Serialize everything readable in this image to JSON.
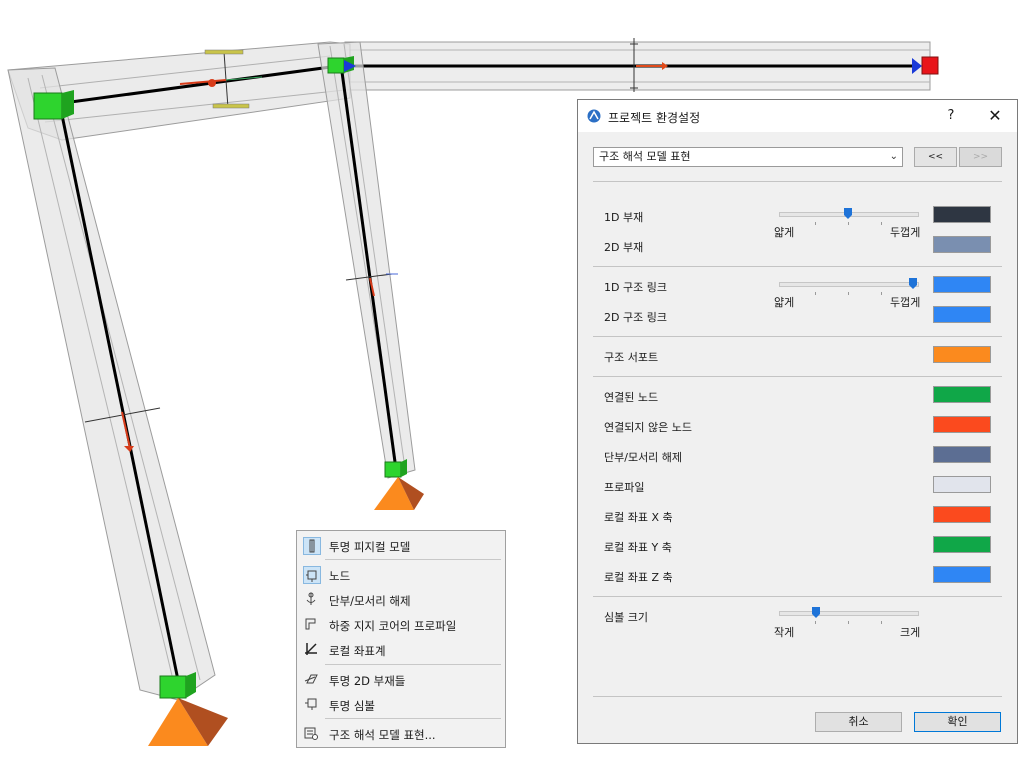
{
  "dialog": {
    "title": "프로젝트 환경설정",
    "help_label": "?",
    "close_label": "✕",
    "page_select_value": "구조 해석 모델 표현",
    "prev_label": "<<",
    "next_label": ">>",
    "rows": {
      "member_1d": "1D 부재",
      "member_2d": "2D 부재",
      "link_1d": "1D 구조 링크",
      "link_2d": "2D 구조 링크",
      "support": "구조 서포트",
      "connected_node": "연결된 노드",
      "unconnected_node": "연결되지 않은 노드",
      "release": "단부/모서리 해제",
      "profile": "프로파일",
      "local_x": "로컬 좌표 X 축",
      "local_y": "로컬 좌표 Y 축",
      "local_z": "로컬 좌표 Z 축",
      "symbol_size": "심볼 크기"
    },
    "sliders": {
      "member_thickness": {
        "min_label": "얇게",
        "max_label": "두껍게",
        "level": 0.5
      },
      "link_thickness": {
        "min_label": "얇게",
        "max_label": "두껍게",
        "level": 1.0
      },
      "symbol_size": {
        "min_label": "작게",
        "max_label": "크게",
        "level": 0.25
      }
    },
    "colors": {
      "member_1d": "#2e3642",
      "member_2d": "#7a8fb0",
      "link_1d": "#2f86f4",
      "link_2d": "#2f86f4",
      "support": "#fb8a1e",
      "connected_node": "#10a748",
      "unconnected_node": "#fb4a1e",
      "release": "#5c6e93",
      "profile": "#e1e4ec",
      "local_x": "#fb4a1e",
      "local_y": "#10a748",
      "local_z": "#2f86f4"
    },
    "cancel_label": "취소",
    "ok_label": "확인"
  },
  "context_menu": {
    "items": [
      {
        "label": "투명 피지컬 모델",
        "icon": "transparent-physical-model-icon",
        "selected": true
      },
      {
        "label": "노드",
        "icon": "node-icon",
        "selected": true
      },
      {
        "label": "단부/모서리 해제",
        "icon": "release-icon",
        "selected": false
      },
      {
        "label": "하중 지지 코어의 프로파일",
        "icon": "core-profile-icon",
        "selected": false
      },
      {
        "label": "로컬 좌표계",
        "icon": "local-axes-icon",
        "selected": false
      },
      {
        "label": "투명 2D 부재들",
        "icon": "transparent-2d-members-icon",
        "selected": false
      },
      {
        "label": "투명 심볼",
        "icon": "transparent-symbols-icon",
        "selected": false
      },
      {
        "label": "구조 해석 모델 표현...",
        "icon": "model-display-settings-icon",
        "selected": false
      }
    ]
  }
}
